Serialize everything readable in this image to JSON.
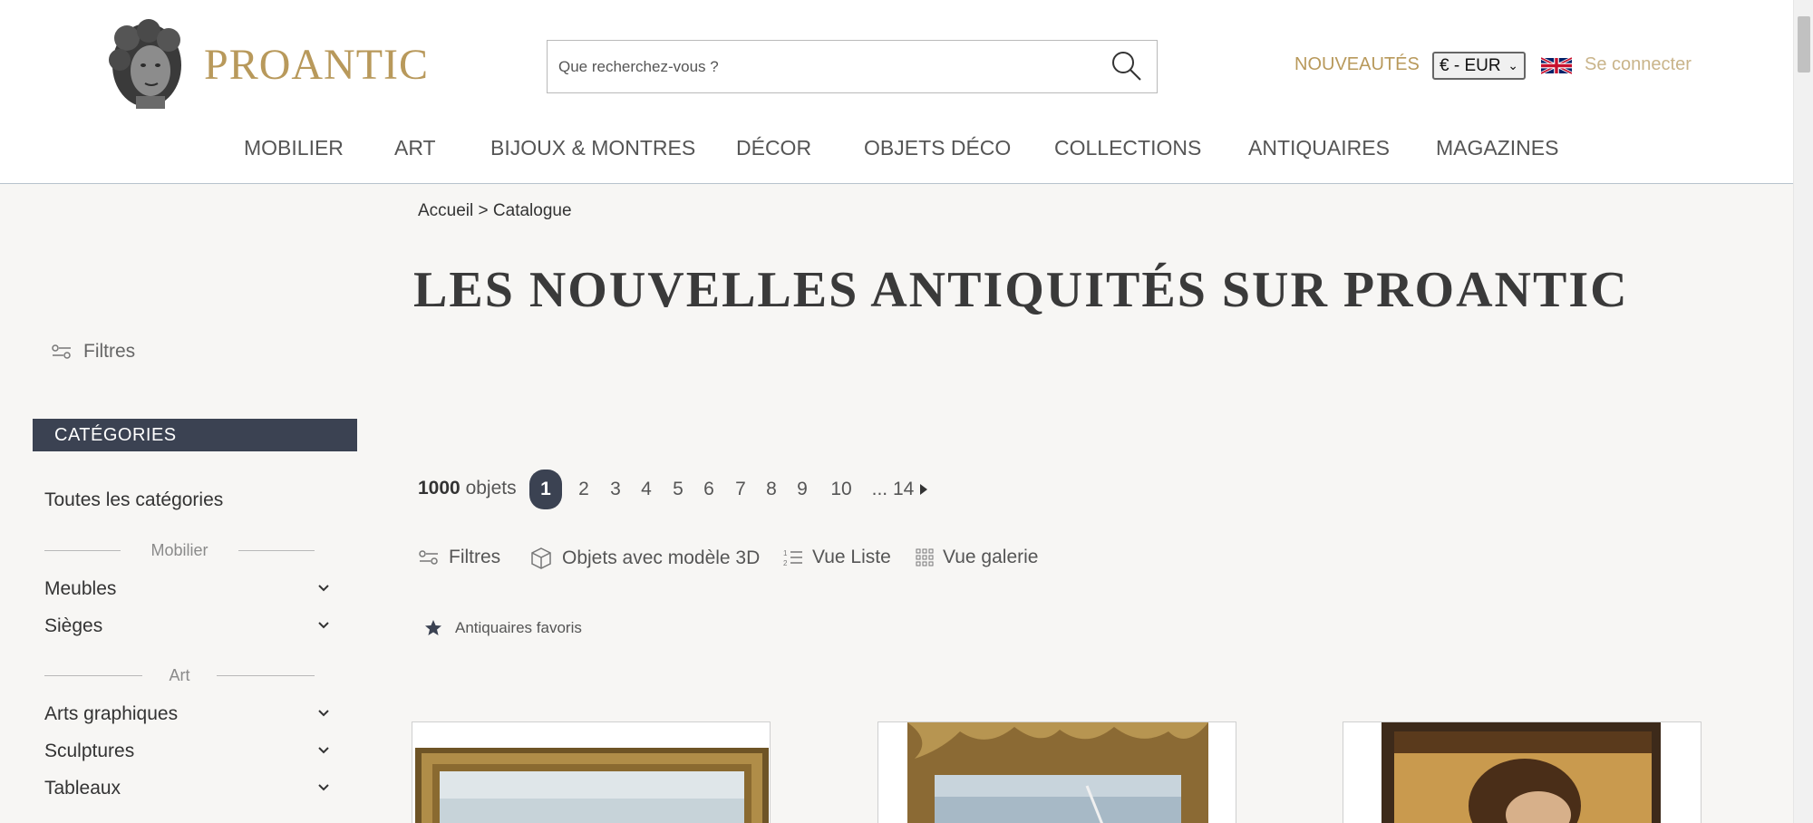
{
  "header": {
    "brand": "PROANTIC",
    "search_placeholder": "Que recherchez-vous ?",
    "nouveautes": "NOUVEAUTÉS",
    "currency": "€ - EUR",
    "login": "Se connecter"
  },
  "nav": [
    "MOBILIER",
    "ART",
    "BIJOUX & MONTRES",
    "DÉCOR",
    "OBJETS DÉCO",
    "COLLECTIONS",
    "ANTIQUAIRES",
    "MAGAZINES"
  ],
  "breadcrumb": "Accueil > Catalogue",
  "title": "LES NOUVELLES ANTIQUITÉS SUR PROANTIC",
  "sidebar": {
    "filters": "Filtres",
    "categories_header": "CATÉGORIES",
    "all": "Toutes les catégories",
    "group_mobilier": "Mobilier",
    "meubles": "Meubles",
    "sieges": "Sièges",
    "group_art": "Art",
    "arts_graphiques": "Arts graphiques",
    "sculptures": "Sculptures",
    "tableaux": "Tableaux"
  },
  "results": {
    "count": "1000",
    "count_unit": "objets",
    "pages": [
      "1",
      "2",
      "3",
      "4",
      "5",
      "6",
      "7",
      "8",
      "9",
      "10",
      "... 14"
    ]
  },
  "toolbar": {
    "filters": "Filtres",
    "objects_3d": "Objets avec modèle 3D",
    "list_view": "Vue Liste",
    "gallery_view": "Vue galerie",
    "favorites": "Antiquaires favoris"
  },
  "colors": {
    "accent": "#b8995b",
    "dark": "#3b4252",
    "background": "#f7f6f4"
  }
}
